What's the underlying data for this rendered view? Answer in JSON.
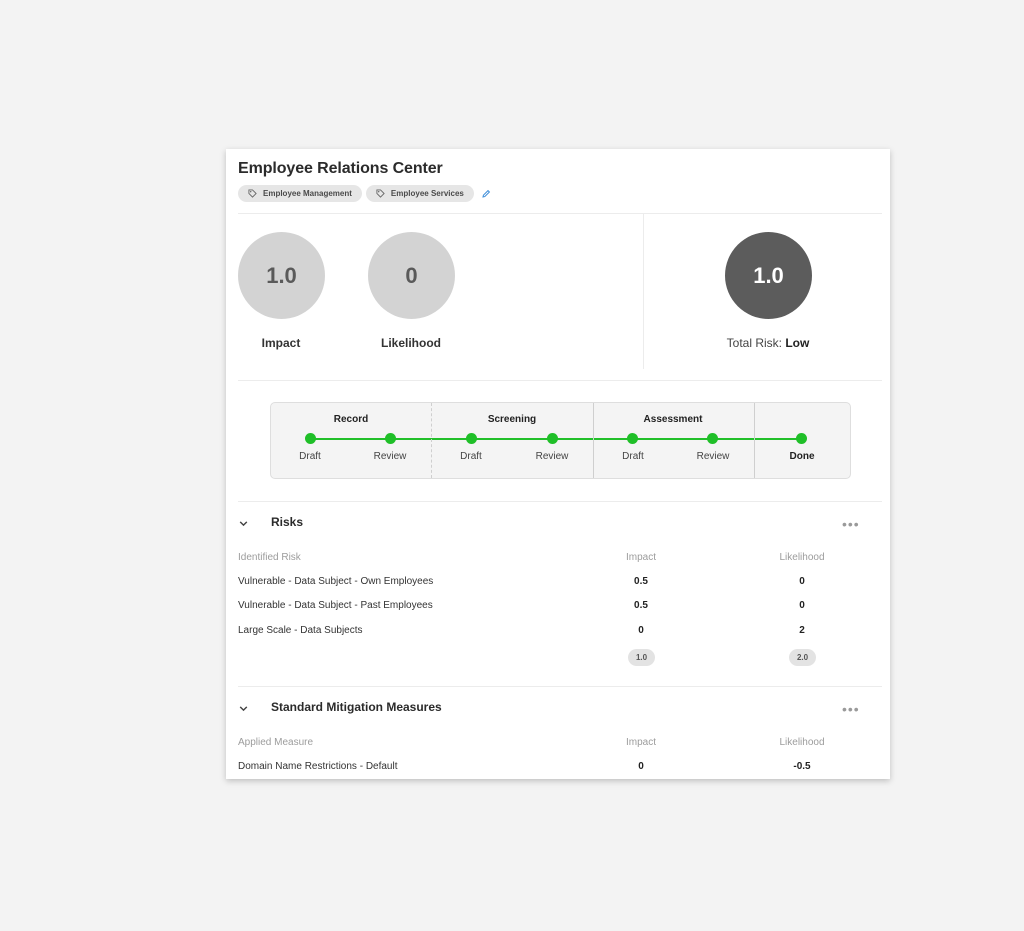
{
  "header": {
    "title": "Employee Relations Center",
    "tags": [
      "Employee Management",
      "Employee Services"
    ],
    "tag_icon": "tag-icon",
    "edit_icon": "pencil-icon"
  },
  "scores": {
    "impact": {
      "value": "1.0",
      "label": "Impact"
    },
    "likelihood": {
      "value": "0",
      "label": "Likelihood"
    },
    "total": {
      "value": "1.0",
      "label_prefix": "Total Risk:",
      "label_value": "Low"
    }
  },
  "workflow": {
    "stages": [
      {
        "name": "Record",
        "steps": [
          "Draft",
          "Review"
        ]
      },
      {
        "name": "Screening",
        "steps": [
          "Draft",
          "Review"
        ]
      },
      {
        "name": "Assessment",
        "steps": [
          "Draft",
          "Review"
        ]
      }
    ],
    "final_step": "Done",
    "accent_color": "#1fbf28"
  },
  "risks": {
    "title": "Risks",
    "more_label": "•••",
    "columns": [
      "Identified Risk",
      "Impact",
      "Likelihood"
    ],
    "rows": [
      {
        "name": "Vulnerable - Data Subject - Own Employees",
        "impact": "0.5",
        "likelihood": "0"
      },
      {
        "name": "Vulnerable - Data Subject - Past Employees",
        "impact": "0.5",
        "likelihood": "0"
      },
      {
        "name": "Large Scale - Data Subjects",
        "impact": "0",
        "likelihood": "2"
      }
    ],
    "totals": {
      "impact": "1.0",
      "likelihood": "2.0"
    }
  },
  "mitigation": {
    "title": "Standard Mitigation Measures",
    "more_label": "•••",
    "columns": [
      "Applied Measure",
      "Impact",
      "Likelihood"
    ],
    "rows": [
      {
        "name": "Domain Name Restrictions - Default",
        "impact": "0",
        "likelihood": "-0.5"
      }
    ]
  },
  "colors": {
    "score_light": "#d3d3d3",
    "score_dark": "#5c5c5c",
    "progress_green": "#22c02a"
  }
}
